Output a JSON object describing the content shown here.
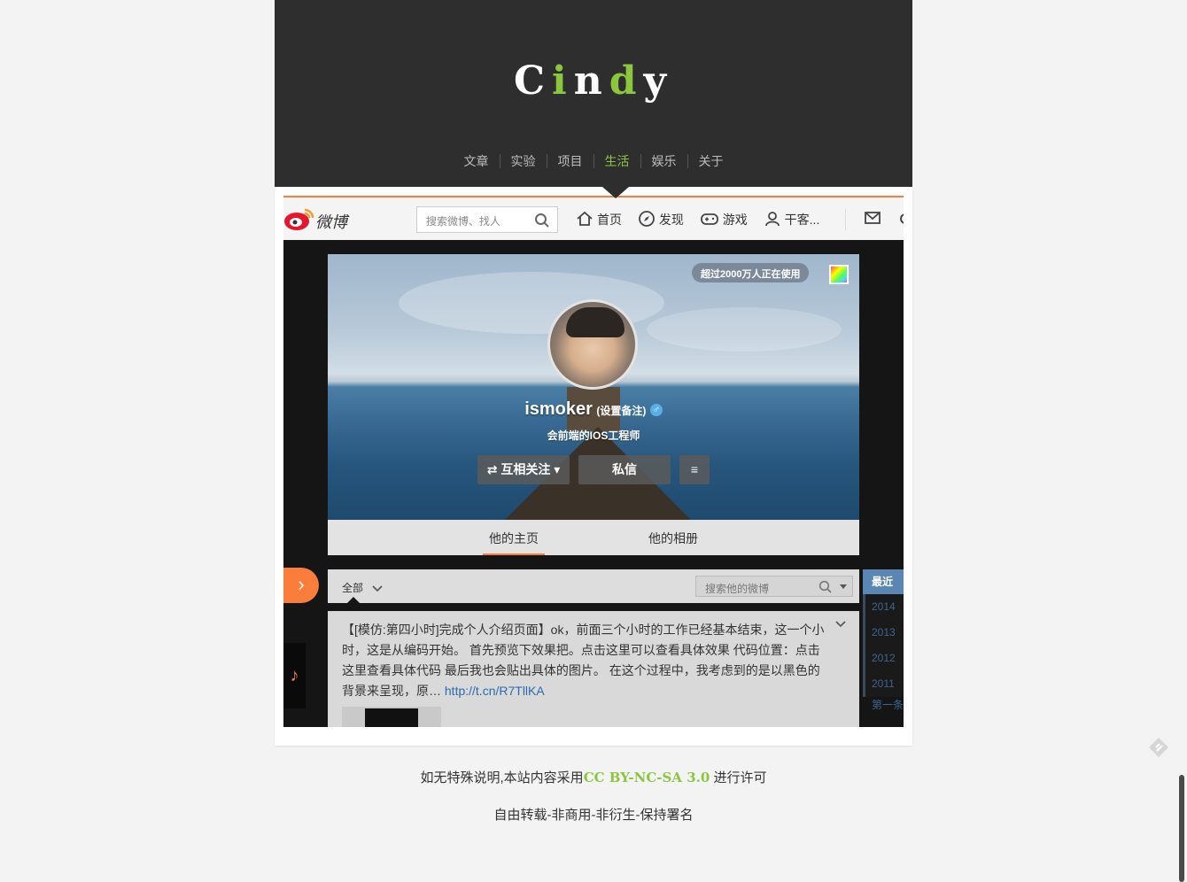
{
  "blog": {
    "logo": [
      "C",
      "i",
      "n",
      "d",
      "y"
    ],
    "nav": [
      "文章",
      "实验",
      "项目",
      "生活",
      "娱乐",
      "关于"
    ],
    "active_nav": "生活",
    "accent_color": "#8cc63f"
  },
  "weibo": {
    "logo_text": "微博",
    "search_placeholder": "搜索微博、找人",
    "nav": {
      "home": "首页",
      "discover": "发现",
      "games": "游戏",
      "user": "干客..."
    },
    "users_badge": "超过2000万人正在使用",
    "profile": {
      "name": "ismoker",
      "remark": "(设置备注)",
      "gender": "♂",
      "bio": "会前端的IOS工程师",
      "follow_button": "⇄ 互相关注 ▾",
      "message_button": "私信",
      "menu_button": "≡"
    },
    "tabs": {
      "home": "他的主页",
      "album": "他的相册"
    },
    "filter": {
      "all": "全部",
      "search_placeholder": "搜索他的微博"
    },
    "years": {
      "head": "最近",
      "list": [
        "2014",
        "2013",
        "2012",
        "2011"
      ],
      "first": "第一条"
    },
    "post": {
      "text": "【[模仿:第四小时]完成个人介绍页面】ok，前面三个小时的工作已经基本结束，这一个小时，这是从编码开始。 首先预览下效果把。点击这里可以查看具体效果 代码位置：点击这里查看具体代码 最后我也会贴出具体的图片。 在这个过程中，我考虑到的是以黑色的背景来呈现，原…",
      "link": "http://t.cn/R7TllKA"
    },
    "brand_color": "#fa7d3c"
  },
  "footer": {
    "line1_prefix": "如无特殊说明,本站内容采用",
    "license": "CC BY-NC-SA 3.0",
    "line1_suffix": " 进行许可",
    "line2": "自由转载-非商用-非衍生-保持署名"
  }
}
